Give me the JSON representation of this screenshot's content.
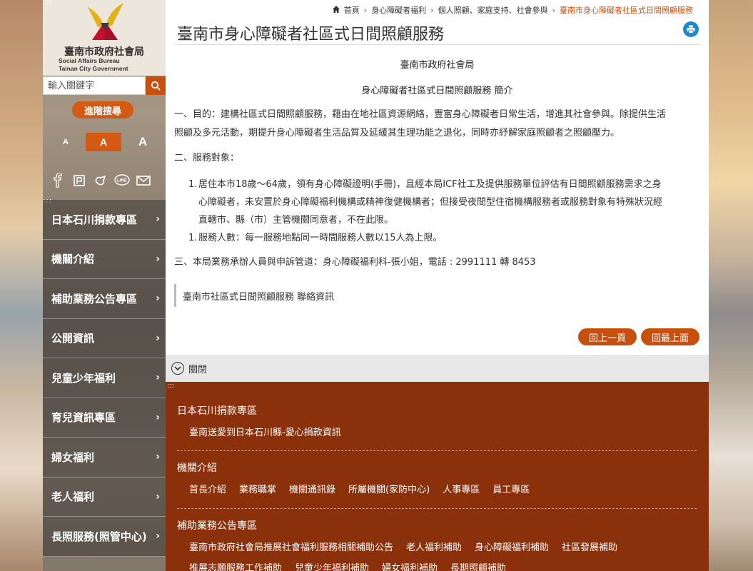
{
  "org": {
    "name_cn": "臺南市政府社會局",
    "name_en1": "Social Affairs Bureau",
    "name_en2": "Tainan City Government"
  },
  "search": {
    "placeholder": "輸入關鍵字",
    "advanced_label": "進階搜尋"
  },
  "font_sizes": [
    "A",
    "A",
    "A"
  ],
  "social_icons": [
    "facebook-icon",
    "plurk-icon",
    "share-icon",
    "line-icon",
    "mail-icon"
  ],
  "menu": [
    {
      "label": "日本石川捐款專區"
    },
    {
      "label": "機關介紹"
    },
    {
      "label": "補助業務公告專區"
    },
    {
      "label": "公開資訊"
    },
    {
      "label": "兒童少年福利"
    },
    {
      "label": "育兒資訊專區"
    },
    {
      "label": "婦女福利"
    },
    {
      "label": "老人福利"
    },
    {
      "label": "長照服務(照管中心)"
    }
  ],
  "breadcrumb": {
    "home": "首頁",
    "level1": "身心障礙者福利",
    "level2": "個人照顧、家庭支持、社會參與",
    "current": "臺南市身心障礙者社區式日間照顧服務"
  },
  "page": {
    "title": "臺南市身心障礙者社區式日間照顧服務",
    "org_line": "臺南市政府社會局",
    "intro_heading": "身心障礙者社區式日間照顧服務 簡介",
    "purpose_line1": "一、目的：建構社區式日間照顧服務，藉由在地社區資源網絡，豐富身心障礙者日常生活，增進其社會參與。除提供生活",
    "purpose_line2": "照顧及多元活動，期提升身心障礙者生活品質及延緩其生理功能之退化，同時亦紓解家庭照顧者之照顧壓力。",
    "target_heading": "二、服務對象：",
    "item1_num": "1.",
    "item1_line1": "居住本市18歲～64歲，領有身心障礙證明(手冊)，且經本局ICF社工及提供服務單位評估有日間照顧服務需求之身",
    "item1_line2": "心障礙者，未安置於身心障礙福利機構或精神復健機構者；但接受夜間型住宿機構服務者或服務對象有特殊狀況經",
    "item1_line3": "直轄市、縣（市）主管機關同意者，不在此限。",
    "item2_num": "1.",
    "item2_line1": "服務人數：每一服務地點同一時間服務人數以15人為上限。",
    "contact_line": "三、本局業務承辦人員與申訴管道：身心障礙福利科-張小姐，電話 : 2991111 轉 8453",
    "contact_box": "臺南市社區式日間照顧服務 聯絡資訊",
    "back_label": "回上一頁",
    "top_label": "回最上面",
    "close_label": "關閉"
  },
  "footer": {
    "groups": [
      {
        "heading": "日本石川捐款專區",
        "links": [
          "臺南送愛到日本石川縣-愛心捐款資訊"
        ]
      },
      {
        "heading": "機關介紹",
        "links": [
          "首長介紹",
          "業務職掌",
          "機關通訊錄",
          "所屬機關(家防中心)",
          "人事專區",
          "員工專區"
        ]
      },
      {
        "heading": "補助業務公告專區",
        "links": [
          "臺南市政府社會局推展社會福利服務相關補助公告",
          "老人福利補助",
          "身心障礙福利補助",
          "社區發展補助"
        ]
      },
      {
        "heading": "",
        "links": [
          "推展志願服務工作補助",
          "兒童少年福利補助",
          "婦女福利補助",
          "長期照顧補助"
        ]
      }
    ]
  },
  "colors": {
    "accent": "#c8500f",
    "footer_bg": "#8a300a",
    "print_blue": "#1e8bc8"
  }
}
